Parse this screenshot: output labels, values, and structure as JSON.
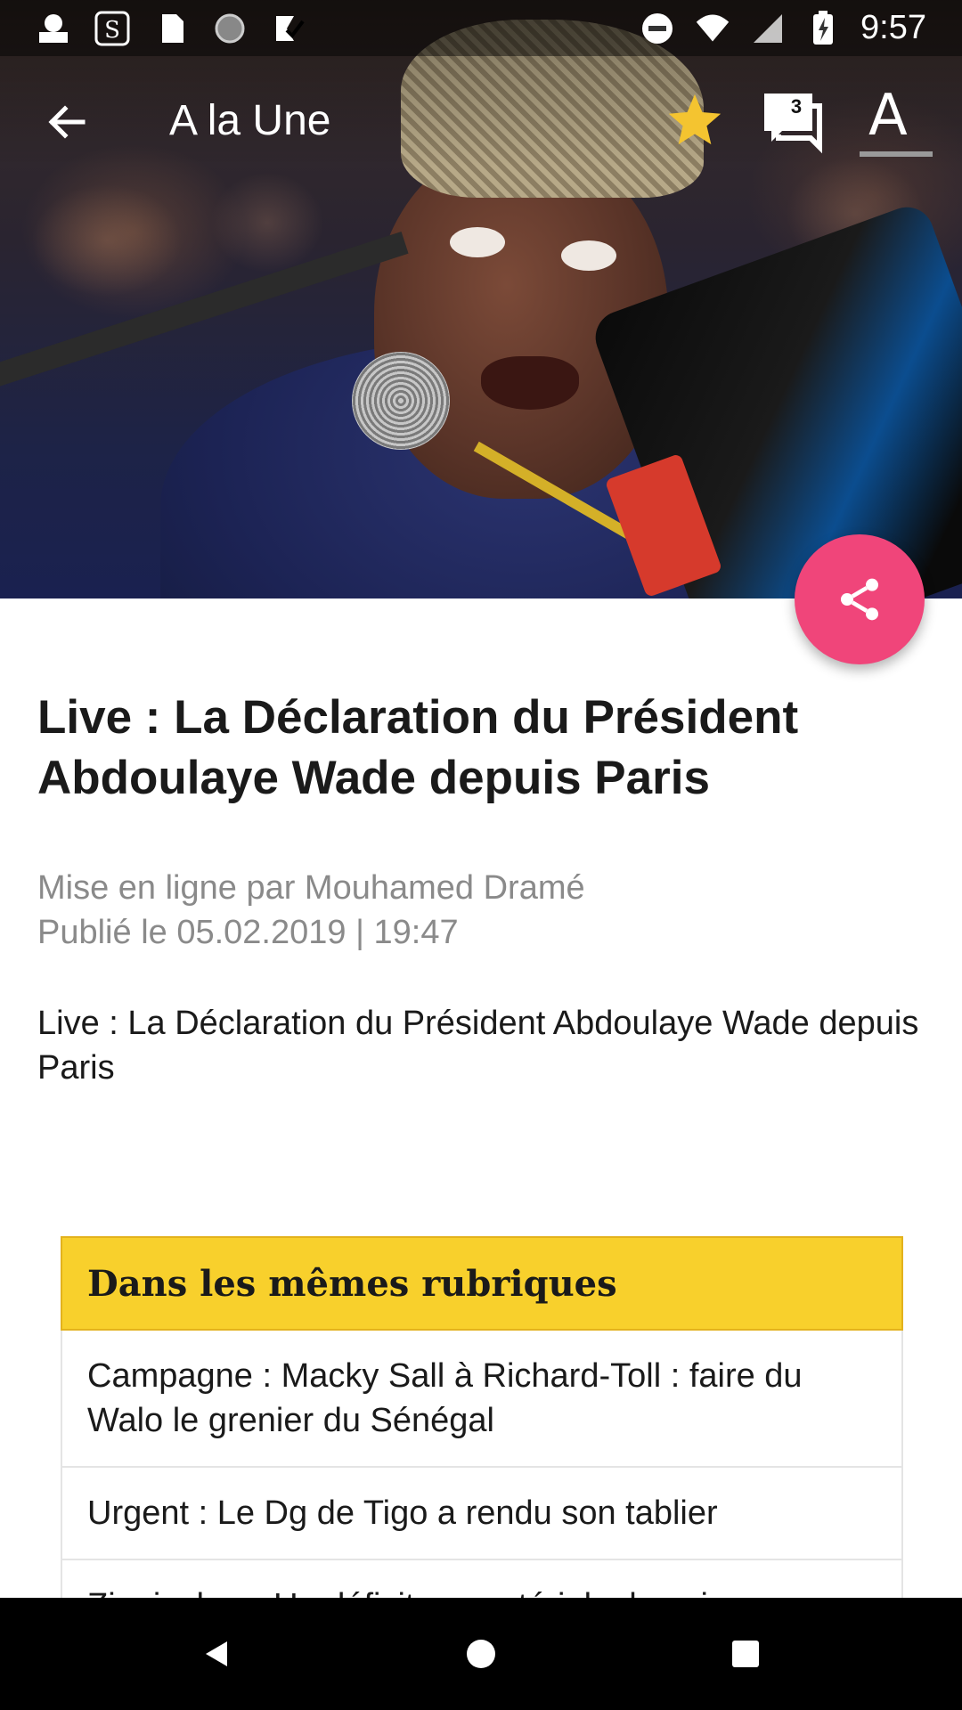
{
  "status_bar": {
    "time": "9:57",
    "left_icons": [
      "app-logo-icon",
      "sudoku-app-icon",
      "sd-card-icon",
      "sync-circle-icon",
      "checklist-icon"
    ],
    "right_icons": [
      "do-not-disturb-icon",
      "wifi-icon",
      "cell-signal-icon",
      "battery-charging-icon"
    ]
  },
  "app_bar": {
    "title": "A la Une",
    "comments_count": "3",
    "font_label": "A",
    "star_color": "#f4c430"
  },
  "article": {
    "title": "Live : La Déclaration du Président Abdoulaye Wade depuis Paris",
    "author_line": "Mise en ligne par Mouhamed Dramé",
    "date_line": "Publié le 05.02.2019 | 19:47",
    "summary": "Live : La Déclaration du Président Abdoulaye Wade depuis Paris"
  },
  "related": {
    "header": "Dans les mêmes rubriques",
    "header_color": "#f8d02c",
    "items": [
      "Campagne : Macky Sall à Richard-Toll : faire du Walo le grenier du Sénégal",
      "Urgent : Le Dg de Tigo a rendu son tablier",
      "Ziguinchor : Un déficit en matériels de soin"
    ]
  },
  "share": {
    "color": "#f0457a"
  },
  "nav_bar": {
    "icons": [
      "back-triangle-icon",
      "home-circle-icon",
      "recents-square-icon"
    ]
  }
}
